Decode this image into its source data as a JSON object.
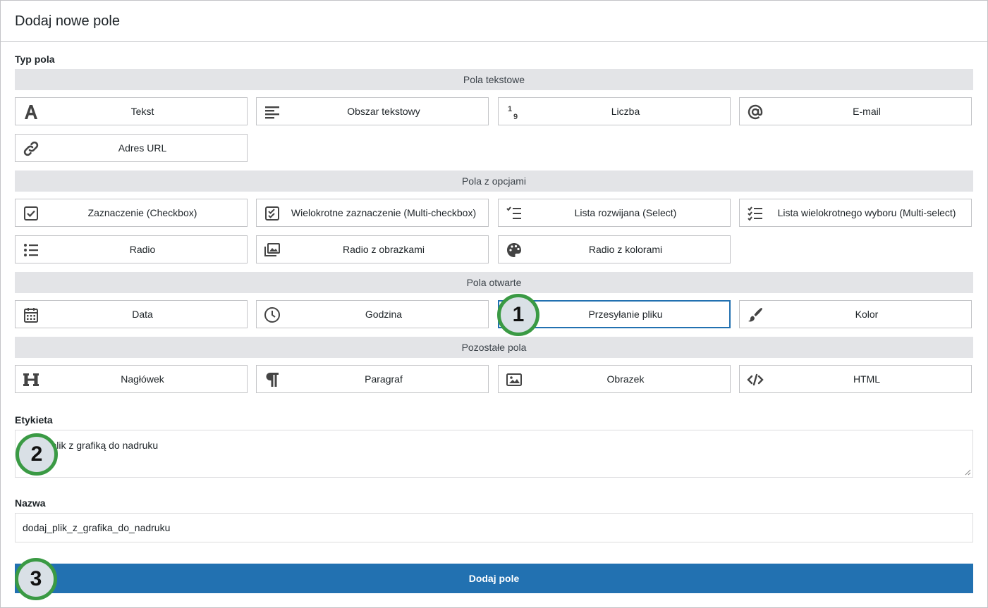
{
  "header": {
    "title": "Dodaj nowe pole"
  },
  "field_type": {
    "label": "Typ pola",
    "groups": [
      {
        "title": "Pola tekstowe",
        "items": [
          {
            "label": "Tekst",
            "icon": "letter-a-icon"
          },
          {
            "label": "Obszar tekstowy",
            "icon": "align-left-icon"
          },
          {
            "label": "Liczba",
            "icon": "number-icon"
          },
          {
            "label": "E-mail",
            "icon": "at-sign-icon"
          },
          {
            "label": "Adres URL",
            "icon": "link-icon"
          }
        ]
      },
      {
        "title": "Pola z opcjami",
        "items": [
          {
            "label": "Zaznaczenie (Checkbox)",
            "icon": "checkbox-icon"
          },
          {
            "label": "Wielokrotne zaznaczenie (Multi-checkbox)",
            "icon": "multi-checkbox-icon"
          },
          {
            "label": "Lista rozwijana (Select)",
            "icon": "check-list-icon"
          },
          {
            "label": "Lista wielokrotnego wyboru (Multi-select)",
            "icon": "multi-check-list-icon"
          },
          {
            "label": "Radio",
            "icon": "bullet-list-icon"
          },
          {
            "label": "Radio z obrazkami",
            "icon": "images-icon"
          },
          {
            "label": "Radio z kolorami",
            "icon": "palette-icon"
          }
        ]
      },
      {
        "title": "Pola otwarte",
        "items": [
          {
            "label": "Data",
            "icon": "calendar-icon"
          },
          {
            "label": "Godzina",
            "icon": "clock-icon"
          },
          {
            "label": "Przesyłanie pliku",
            "icon": "upload-icon",
            "selected": true
          },
          {
            "label": "Kolor",
            "icon": "brush-icon"
          }
        ]
      },
      {
        "title": "Pozostałe pola",
        "items": [
          {
            "label": "Nagłówek",
            "icon": "heading-icon"
          },
          {
            "label": "Paragraf",
            "icon": "paragraph-icon"
          },
          {
            "label": "Obrazek",
            "icon": "image-icon"
          },
          {
            "label": "HTML",
            "icon": "code-icon"
          }
        ]
      }
    ]
  },
  "etykieta": {
    "label": "Etykieta",
    "value": "Dodaj plik z grafiką do nadruku"
  },
  "nazwa": {
    "label": "Nazwa",
    "value": "dodaj_plik_z_grafika_do_nadruku"
  },
  "submit": {
    "label": "Dodaj pole"
  },
  "callouts": [
    "1",
    "2",
    "3"
  ],
  "colors": {
    "accent": "#2271b1",
    "callout_ring": "#3a9a44",
    "group_bar": "#e3e4e7"
  }
}
